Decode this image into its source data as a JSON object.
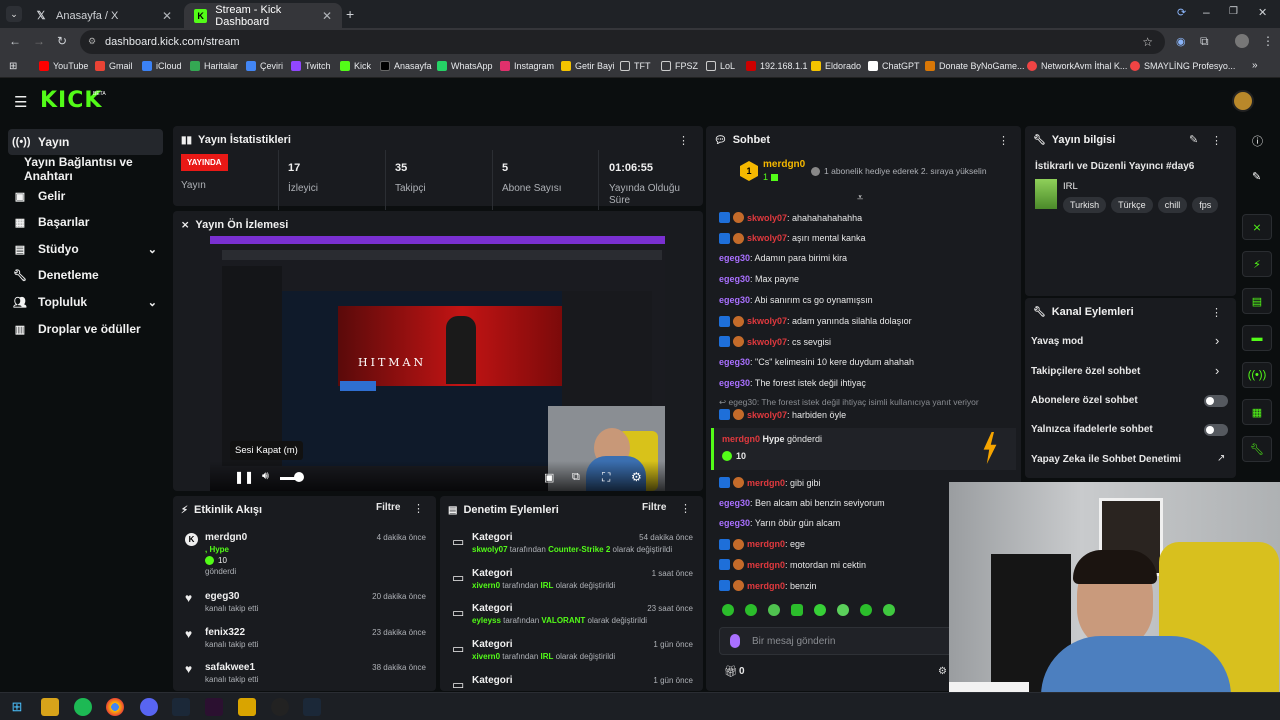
{
  "browser": {
    "tabs": [
      {
        "label": "Anasayfa / X",
        "favicon": "x-icon"
      },
      {
        "label": "Stream - Kick Dashboard",
        "favicon": "kick-icon"
      }
    ],
    "url": "dashboard.kick.com/stream",
    "bookmarks": [
      "YouTube",
      "Gmail",
      "iCloud",
      "Haritalar",
      "Çeviri",
      "Twitch",
      "Kick",
      "Anasayfa",
      "WhatsApp",
      "Instagram",
      "Getir Bayi",
      "TFT",
      "FPSZ",
      "LoL",
      "192.168.1.1",
      "Eldorado",
      "ChatGPT",
      "Donate ByNoGame...",
      "NetworkAvm İthal K...",
      "SMAYLİNG Profesyo..."
    ]
  },
  "header": {
    "logo": "KICK",
    "beta": "BETA"
  },
  "sidebar": {
    "items": [
      {
        "label": "Yayın",
        "icon": "broadcast-icon"
      },
      {
        "label": "Yayın Bağlantısı ve Anahtarı"
      },
      {
        "label": "Gelir",
        "icon": "money-icon"
      },
      {
        "label": "Başarılar",
        "icon": "trophy-icon"
      },
      {
        "label": "Stüdyo",
        "icon": "studio-icon"
      },
      {
        "label": "Denetleme",
        "icon": "wrench-icon"
      },
      {
        "label": "Topluluk",
        "icon": "people-icon"
      },
      {
        "label": "Droplar ve ödüller",
        "icon": "gift-icon"
      }
    ]
  },
  "stats": {
    "title": "Yayın İstatistikleri",
    "live_badge": "YAYINDA",
    "items": [
      {
        "value": "",
        "label": "Yayın"
      },
      {
        "value": "17",
        "label": "İzleyici"
      },
      {
        "value": "35",
        "label": "Takipçi"
      },
      {
        "value": "5",
        "label": "Abone Sayısı"
      },
      {
        "value": "01:06:55",
        "label": "Yayında Olduğu Süre"
      }
    ]
  },
  "preview": {
    "title": "Yayın Ön İzlemesi",
    "tooltip": "Sesi Kapat (m)"
  },
  "activity": {
    "title": "Etkinlik Akışı",
    "filter": "Filtre",
    "items": [
      {
        "name": "merdgn0",
        "line2": ", Hype",
        "line3": "10",
        "line4": "gönderdi",
        "time": "4 dakika önce",
        "icon": "kick-icon"
      },
      {
        "name": "egeg30",
        "line2": "kanalı takip etti",
        "time": "20 dakika önce",
        "icon": "heart-icon"
      },
      {
        "name": "fenix322",
        "line2": "kanalı takip etti",
        "time": "23 dakika önce",
        "icon": "heart-icon"
      },
      {
        "name": "safakwee1",
        "line2": "kanalı takip etti",
        "time": "38 dakika önce",
        "icon": "heart-icon"
      }
    ]
  },
  "moderation": {
    "title": "Denetim Eylemleri",
    "filter": "Filtre",
    "items": [
      {
        "title": "Kategori",
        "user": "skwoly07",
        "mid": " tarafından ",
        "value": "Counter-Strike 2",
        "end": " olarak değiştirildi",
        "time": "54 dakika önce"
      },
      {
        "title": "Kategori",
        "user": "xivern0",
        "mid": " tarafından ",
        "value": "IRL",
        "end": " olarak değiştirildi",
        "time": "1 saat önce"
      },
      {
        "title": "Kategori",
        "user": "eyleyss",
        "mid": " tarafından ",
        "value": "VALORANT",
        "end": " olarak değiştirildi",
        "time": "23 saat önce"
      },
      {
        "title": "Kategori",
        "user": "xivern0",
        "mid": " tarafından ",
        "value": "IRL",
        "end": " olarak değiştirildi",
        "time": "1 gün önce"
      },
      {
        "title": "Kategori",
        "time": "1 gün önce"
      }
    ]
  },
  "chat": {
    "title": "Sohbet",
    "top_gifter": {
      "rank": "1",
      "name": "merdgn0",
      "count": "1",
      "note": "1 abonelik hediye ederek 2. sıraya yükselin"
    },
    "messages": [
      {
        "user": "skwoly07",
        "text": ": ahahahahahahha",
        "color": "#e0393e",
        "badges": true
      },
      {
        "user": "skwoly07",
        "text": ": aşırı mental kanka",
        "color": "#e0393e",
        "badges": true
      },
      {
        "user": "egeg30",
        "text": ": Adamın para birimi kira",
        "color": "#a970ff"
      },
      {
        "user": "egeg30",
        "text": ": Max payne",
        "color": "#a970ff"
      },
      {
        "user": "egeg30",
        "text": ": Abi sanırım cs go oynamışsın",
        "color": "#a970ff"
      },
      {
        "user": "skwoly07",
        "text": ": adam yanında silahla dolaşıor",
        "color": "#e0393e",
        "badges": true
      },
      {
        "user": "skwoly07",
        "text": ": cs sevgisi",
        "color": "#e0393e",
        "badges": true
      },
      {
        "user": "egeg30",
        "text": ": \"Cs\" kelimesini 10 kere duydum ahahah",
        "color": "#a970ff"
      },
      {
        "user": "egeg30",
        "text": ": The forest istek değil ihtiyaç",
        "color": "#a970ff"
      }
    ],
    "reply_note": "egeg30: The forest istek değil ihtiyaç isimli kullanıcıya yanıt veriyor",
    "reply_msg": {
      "user": "skwoly07",
      "text": ": harbiden öyle"
    },
    "hype": {
      "user": "merdgn0",
      "text": " Hype",
      "tail": " gönderdi",
      "amount": "10"
    },
    "messages2": [
      {
        "user": "merdgn0",
        "text": ": gibi gibi",
        "color": "#e0393e",
        "badges": true
      },
      {
        "user": "egeg30",
        "text": ": Ben alcam abi benzin seviyorum",
        "color": "#a970ff"
      },
      {
        "user": "egeg30",
        "text": ": Yarın öbür gün alcam",
        "color": "#a970ff"
      },
      {
        "user": "merdgn0",
        "text": ": ege",
        "color": "#e0393e",
        "badges": true
      },
      {
        "user": "merdgn0",
        "text": ": motordan mi cektin",
        "color": "#e0393e",
        "badges": true
      },
      {
        "user": "merdgn0",
        "text": ": benzin",
        "color": "#e0393e",
        "badges": true
      }
    ],
    "input_placeholder": "Bir mesaj gönderin",
    "points": "0"
  },
  "stream_info": {
    "title": "Yayın bilgisi",
    "stream_title": "İstikrarlı ve Düzenli Yayıncı #day6",
    "category": "IRL",
    "tags": [
      "Turkish",
      "Türkçe",
      "chill",
      "fps"
    ]
  },
  "channel_actions": {
    "title": "Kanal Eylemleri",
    "items": [
      {
        "label": "Yavaş mod",
        "control": "chevron"
      },
      {
        "label": "Takipçilere özel sohbet",
        "control": "chevron"
      },
      {
        "label": "Abonelere özel sohbet",
        "control": "toggle"
      },
      {
        "label": "Yalnızca ifadelerle sohbet",
        "control": "toggle"
      },
      {
        "label": "Yapay Zeka ile Sohbet Denetimi",
        "control": "external"
      }
    ]
  },
  "colors": {
    "accent": "#53fc18",
    "live": "#e91916",
    "panel": "#191b1f",
    "bg": "#0b0e0f"
  }
}
